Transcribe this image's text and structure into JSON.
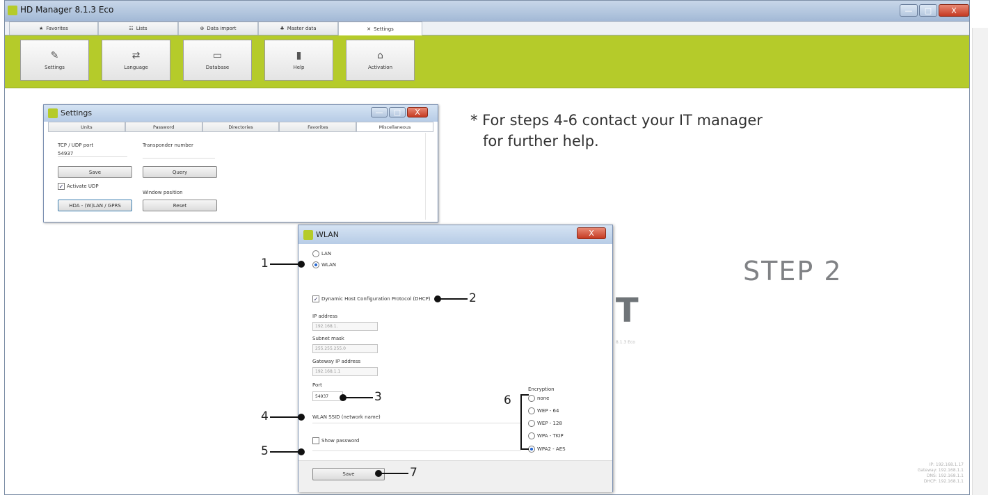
{
  "app": {
    "title": "HD Manager 8.1.3 Eco",
    "minimize": "—",
    "maximize": "□",
    "close": "X"
  },
  "tabs": [
    {
      "icon": "★",
      "label": "Favorites"
    },
    {
      "icon": "☷",
      "label": "Lists"
    },
    {
      "icon": "⊕",
      "label": "Data import"
    },
    {
      "icon": "♣",
      "label": "Master data"
    },
    {
      "icon": "✕",
      "label": "Settings"
    }
  ],
  "ribbon": [
    {
      "icon": "✎",
      "label": "Settings"
    },
    {
      "icon": "⇄",
      "label": "Language"
    },
    {
      "icon": "▭",
      "label": "Database"
    },
    {
      "icon": "▮",
      "label": "Help"
    },
    {
      "icon": "⌂",
      "label": "Activation"
    }
  ],
  "settings_dialog": {
    "title": "Settings",
    "tabs": [
      "Units",
      "Password",
      "Directories",
      "Favorites",
      "Miscellaneous"
    ],
    "tcp_label": "TCP / UDP port",
    "tcp_value": "54937",
    "transponder_label": "Transponder number",
    "save": "Save",
    "query": "Query",
    "activate_udp": "Activate UDP",
    "window_position": "Window position",
    "hda": "HDA - (W)LAN / GPRS",
    "reset": "Reset"
  },
  "note": {
    "line1": "* For steps 4-6 contact your IT manager",
    "line2": "for further help."
  },
  "step": "STEP 2",
  "bg_logo_fragment": "IT",
  "bg_version": "8.1.3 Eco",
  "bg_status": [
    "IP: 192.168.1.17",
    "Gateway: 192.168.1.1",
    "DNS: 192.168.1.1",
    "DHCP: 192.168.1.1"
  ],
  "wlan_dialog": {
    "title": "WLAN",
    "lan": "LAN",
    "wlan": "WLAN",
    "dhcp": "Dynamic Host Configuration Protocol (DHCP)",
    "ip_label": "IP address",
    "ip_value": "192.168.1.",
    "subnet_label": "Subnet mask",
    "subnet_value": "255.255.255.0",
    "gateway_label": "Gateway IP address",
    "gateway_value": "192.168.1.1",
    "port_label": "Port",
    "port_value": "54937",
    "ssid_label": "WLAN SSID (network name)",
    "show_password": "Show password",
    "encryption_label": "Encryption",
    "encryption": [
      "none",
      "WEP - 64",
      "WEP - 128",
      "WPA - TKIP",
      "WPA2 - AES"
    ],
    "encryption_selected": "WPA2 - AES",
    "save": "Save",
    "close": "X"
  },
  "callouts": [
    "1",
    "2",
    "3",
    "4",
    "5",
    "6",
    "7"
  ]
}
